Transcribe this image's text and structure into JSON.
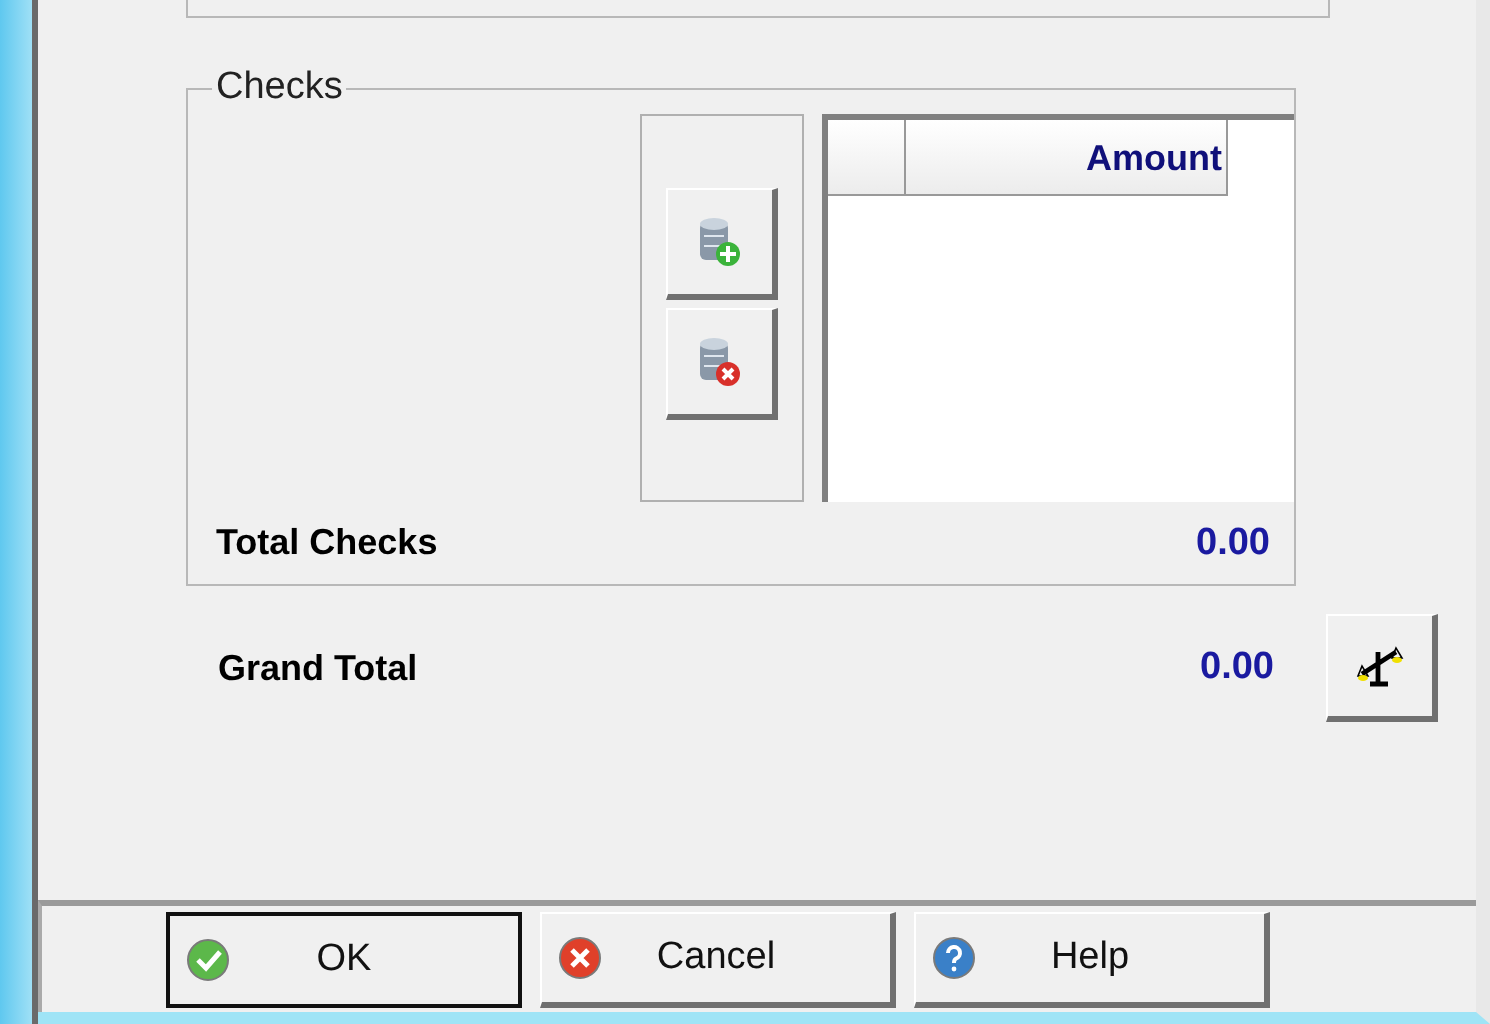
{
  "checks_group": {
    "title": "Checks",
    "buttons": [
      {
        "kind": "add"
      },
      {
        "kind": "remove"
      }
    ],
    "table": {
      "columns": [
        "Amount"
      ]
    },
    "total_label": "Total Checks",
    "total_value": "0.00"
  },
  "grand_total": {
    "label": "Grand Total",
    "value": "0.00"
  },
  "buttons": [
    {
      "label": "OK",
      "kind": "ok",
      "default": true
    },
    {
      "label": "Cancel",
      "kind": "cancel",
      "default": false
    },
    {
      "label": "Help",
      "kind": "help",
      "default": false
    }
  ]
}
